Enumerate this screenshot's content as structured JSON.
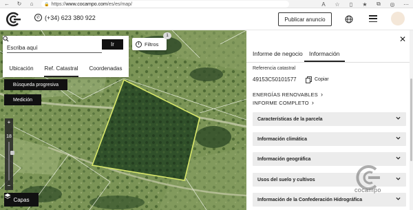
{
  "browser": {
    "url_prefix": "https://",
    "url_host": "www.cocampo.com",
    "url_path": "/es/es/map/"
  },
  "header": {
    "phone": "(+34) 623 380 922",
    "publish_label": "Publicar anuncio"
  },
  "search": {
    "placeholder": "Escriba aquí",
    "go_label": "Ir",
    "tabs": [
      {
        "label": "Ubicación"
      },
      {
        "label": "Ref. Catastral"
      },
      {
        "label": "Coordenadas"
      }
    ],
    "active_tab": "Ref. Catastral"
  },
  "map": {
    "filters_label": "Filtros",
    "filters_count": "1",
    "progressive_search_label": "Búsqueda progresiva",
    "measurement_label": "Medición",
    "zoom_plus": "+",
    "zoom_level": "18",
    "zoom_minus": "−",
    "layers_label": "Capas"
  },
  "panel": {
    "tabs": [
      {
        "label": "Informe de negocio"
      },
      {
        "label": "Información"
      }
    ],
    "active_tab": "Información",
    "ref_label": "Referencia catastral",
    "ref_value": "49153C50101577",
    "copy_label": "Copiar",
    "links": [
      {
        "label": "ENERGÍAS RENOVABLES"
      },
      {
        "label": "INFORME COMPLETO"
      }
    ],
    "sections": [
      {
        "label": "Características de la parcela"
      },
      {
        "label": "Información climática"
      },
      {
        "label": "Información geográfica"
      },
      {
        "label": "Usos del suelo y cultivos"
      },
      {
        "label": "Información de la Confederación Hidrográfica"
      }
    ],
    "brand_text": "cocampo"
  },
  "colors": {
    "accent_dark": "#111111",
    "parcel_outline": "#d9e86a",
    "panel_section_bg": "#ececec",
    "brand_gray": "#7a7a7a"
  }
}
